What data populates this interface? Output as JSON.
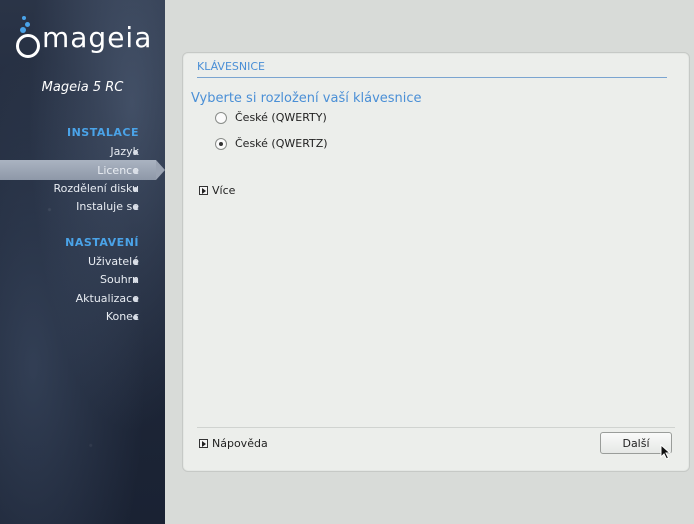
{
  "sidebar": {
    "logo_text": "mageia",
    "version": "Mageia 5 RC",
    "install_title": "INSTALACE",
    "install_steps": [
      "Jazyk",
      "Licence",
      "Rozdělení disku",
      "Instaluje se"
    ],
    "settings_title": "NASTAVENÍ",
    "settings_steps": [
      "Uživatelé",
      "Souhrn",
      "Aktualizace",
      "Konec"
    ],
    "active_step": "Licence"
  },
  "panel": {
    "title": "KLÁVESNICE",
    "question": "Vyberte si rozložení vaší klávesnice",
    "options": [
      {
        "label": "České (QWERTY)",
        "selected": false
      },
      {
        "label": "České (QWERTZ)",
        "selected": true
      }
    ],
    "more_label": "Více",
    "help_label": "Nápověda",
    "next_label": "Další"
  },
  "icons": {
    "logo": "mageia-logo-icon",
    "expander": "expander-arrow-icon",
    "cursor": "mouse-pointer-icon"
  },
  "colors": {
    "accent": "#4a8fd6",
    "sidebar_accent": "#4aa3e8",
    "panel_bg": "#eceeeb"
  }
}
